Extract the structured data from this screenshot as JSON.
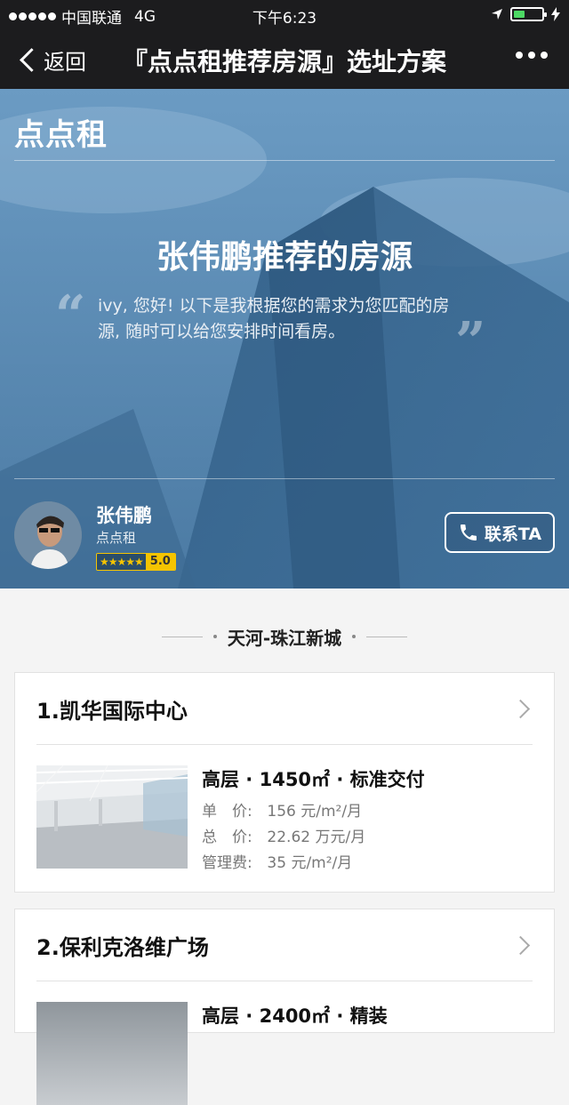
{
  "status_bar": {
    "carrier": "中国联通",
    "network": "4G",
    "time": "下午6:23"
  },
  "nav": {
    "back_label": "返回",
    "title": "『点点租推荐房源』选址方案"
  },
  "hero": {
    "logo": "点点租",
    "title": "张伟鹏推荐的房源",
    "message": "ivy, 您好! 以下是我根据您的需求为您匹配的房源, 随时可以给您安排时间看房。",
    "quote_open": "“",
    "quote_close": "”"
  },
  "agent": {
    "name": "张伟鹏",
    "company": "点点租",
    "stars": "★★★★★",
    "rating": "5.0",
    "contact_label": "联系TA"
  },
  "district": {
    "name": "天河-珠江新城"
  },
  "listings": [
    {
      "title": "1.凯华国际中心",
      "spec": "高层 · 1450㎡ · 标准交付",
      "unit_price_label": "单　价:",
      "unit_price": "156 元/m²/月",
      "total_price_label": "总　价:",
      "total_price": "22.62 万元/月",
      "mgmt_fee_label": "管理费:",
      "mgmt_fee": "35 元/m²/月"
    },
    {
      "title": "2.保利克洛维广场",
      "spec": "高层 · 2400㎡ · 精装"
    }
  ],
  "colors": {
    "topbar": "#1c1c1e",
    "hero_blue": "#4a79a3",
    "rating_gold": "#f5c400"
  }
}
